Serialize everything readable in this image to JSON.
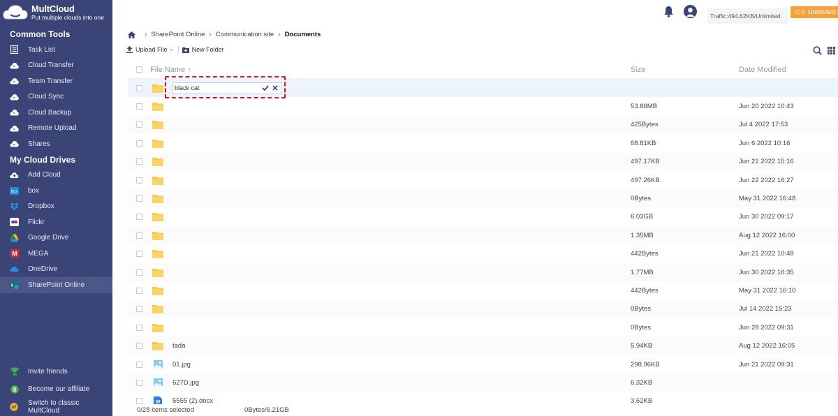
{
  "brand": {
    "name": "MultCloud",
    "tagline": "Put multiple clouds into one"
  },
  "sidebar": {
    "common_tools_title": "Common Tools",
    "common_tools": [
      {
        "label": "Task List",
        "icon": "task-list-icon"
      },
      {
        "label": "Cloud Transfer",
        "icon": "cloud-transfer-icon"
      },
      {
        "label": "Team Transfer",
        "icon": "team-transfer-icon"
      },
      {
        "label": "Cloud Sync",
        "icon": "cloud-sync-icon"
      },
      {
        "label": "Cloud Backup",
        "icon": "cloud-backup-icon"
      },
      {
        "label": "Remote Upload",
        "icon": "remote-upload-icon"
      },
      {
        "label": "Shares",
        "icon": "shares-icon"
      }
    ],
    "drives_title": "My Cloud Drives",
    "drives": [
      {
        "label": "Add Cloud",
        "icon": "add-cloud-icon"
      },
      {
        "label": "box",
        "icon": "box-icon"
      },
      {
        "label": "Dropbox",
        "icon": "dropbox-icon"
      },
      {
        "label": "Flickr",
        "icon": "flickr-icon"
      },
      {
        "label": "Google Drive",
        "icon": "google-drive-icon"
      },
      {
        "label": "MEGA",
        "icon": "mega-icon"
      },
      {
        "label": "OneDrive",
        "icon": "onedrive-icon"
      },
      {
        "label": "SharePoint Online",
        "icon": "sharepoint-icon",
        "active": true
      }
    ],
    "bottom": [
      {
        "label": "Invite friends",
        "icon": "trophy-icon"
      },
      {
        "label": "Become our affiliate",
        "icon": "dollar-icon"
      },
      {
        "label": "Switch to classic MultCloud",
        "icon": "switch-icon"
      }
    ]
  },
  "header": {
    "traffic": "Traffic:494.62KB/Unlimited",
    "unlimited_button": "Unlimited Plan"
  },
  "breadcrumb": [
    "SharePoint Online",
    "Communication site",
    "Documents"
  ],
  "toolbar": {
    "upload": "Upload File",
    "new_folder": "New Folder"
  },
  "table": {
    "headers": {
      "name": "File Name",
      "size": "Size",
      "date": "Date Modified"
    },
    "editing_value": "black cat",
    "rows": [
      {
        "type": "folder",
        "name": "",
        "size": "53.86MB",
        "date": "Jun 20 2022 10:43"
      },
      {
        "type": "folder",
        "name": "",
        "size": "425Bytes",
        "date": "Jul 4 2022 17:53"
      },
      {
        "type": "folder",
        "name": "",
        "size": "68.81KB",
        "date": "Jun 6 2022 10:16"
      },
      {
        "type": "folder",
        "name": "",
        "size": "497.17KB",
        "date": "Jun 21 2022 15:16"
      },
      {
        "type": "folder",
        "name": "",
        "size": "497.26KB",
        "date": "Jun 22 2022 16:27"
      },
      {
        "type": "folder",
        "name": "",
        "size": "0Bytes",
        "date": "May 31 2022 16:48"
      },
      {
        "type": "folder",
        "name": "",
        "size": "6.03GB",
        "date": "Jun 30 2022 09:17"
      },
      {
        "type": "folder",
        "name": "",
        "size": "1.35MB",
        "date": "Aug 12 2022 16:00"
      },
      {
        "type": "folder",
        "name": "",
        "size": "442Bytes",
        "date": "Jun 21 2022 10:48"
      },
      {
        "type": "folder",
        "name": "",
        "size": "1.77MB",
        "date": "Jun 30 2022 16:35"
      },
      {
        "type": "folder",
        "name": "",
        "size": "442Bytes",
        "date": "May 31 2022 16:10"
      },
      {
        "type": "folder",
        "name": "",
        "size": "0Bytes",
        "date": "Jul 14 2022 15:23"
      },
      {
        "type": "folder",
        "name": "",
        "size": "0Bytes",
        "date": "Jun 28 2022 09:31"
      },
      {
        "type": "folder",
        "name": "tada",
        "size": "5.94KB",
        "date": "Aug 12 2022 16:05"
      },
      {
        "type": "image",
        "name": "01.jpg",
        "size": "298.96KB",
        "date": "Jun 21 2022 09:31"
      },
      {
        "type": "image",
        "name": "627D.jpg",
        "size": "6.32KB",
        "date": ""
      },
      {
        "type": "doc",
        "name": "5555 (2).docx",
        "size": "3.62KB",
        "date": ""
      }
    ]
  },
  "status": {
    "selected": "0/28 items selected",
    "storage": "0Bytes/6.21GB"
  },
  "colors": {
    "sidebar": "#3a4476",
    "accent": "#f5a13c",
    "folder": "#f9c94b",
    "highlight": "#d4161d"
  }
}
